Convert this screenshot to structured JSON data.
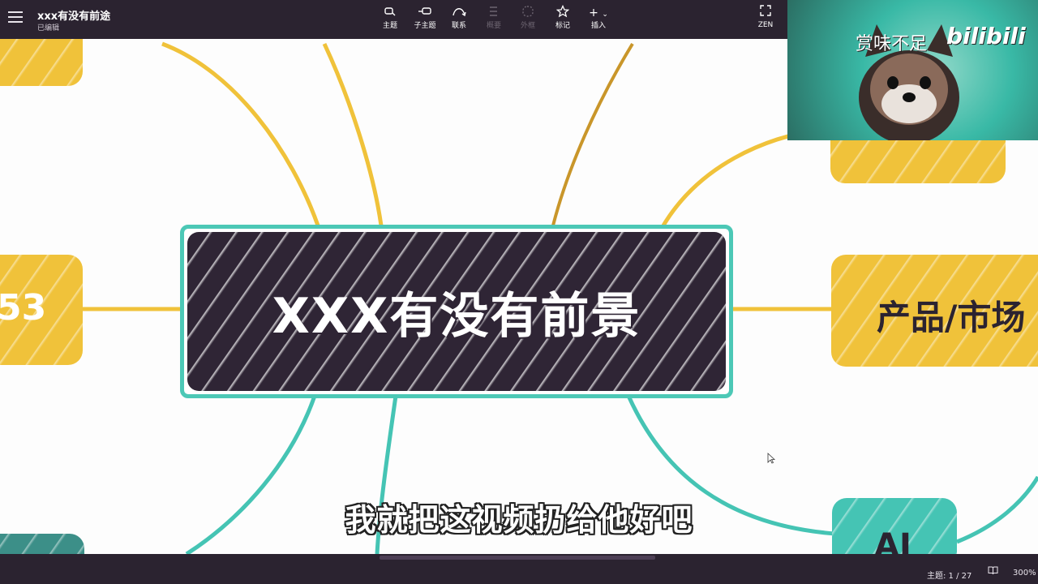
{
  "app": {
    "doc_title": "xxx有没有前途",
    "doc_status": "已编辑"
  },
  "toolbar": {
    "items": [
      {
        "label": "主题",
        "icon": "topic-icon",
        "enabled": true
      },
      {
        "label": "子主题",
        "icon": "subtopic-icon",
        "enabled": true
      },
      {
        "label": "联系",
        "icon": "relationship-icon",
        "enabled": true
      },
      {
        "label": "概要",
        "icon": "summary-icon",
        "enabled": false
      },
      {
        "label": "外框",
        "icon": "boundary-icon",
        "enabled": false
      },
      {
        "label": "标记",
        "icon": "star-icon",
        "enabled": true
      },
      {
        "label": "插入",
        "icon": "plus-icon",
        "enabled": true
      }
    ],
    "zen_label": "ZEN"
  },
  "mindmap": {
    "central_topic": "XXX有没有前景",
    "nodes": [
      {
        "name": "node-top-left",
        "label": "",
        "color": "yellow"
      },
      {
        "name": "node-left-middle",
        "label": "53",
        "color": "yellow"
      },
      {
        "name": "node-top-right",
        "label": "",
        "color": "yellow"
      },
      {
        "name": "node-right-middle",
        "label": "产品/市场",
        "color": "yellow"
      },
      {
        "name": "node-bottom-right",
        "label": "AI",
        "color": "teal"
      },
      {
        "name": "node-bottom-left",
        "label": "",
        "color": "teal"
      }
    ]
  },
  "status": {
    "topic_count": "主题: 1 / 27",
    "zoom": "300%"
  },
  "overlay": {
    "webcam_title": "赏味不足",
    "webcam_logo": "bilibili",
    "subtitle": "我就把这视频扔给他好吧"
  },
  "colors": {
    "toolbar_bg": "#2b2330",
    "central_bg": "#2f2535",
    "central_border": "#4cc8b6",
    "branch_yellow": "#f0c23a",
    "branch_teal": "#45c4b4"
  }
}
